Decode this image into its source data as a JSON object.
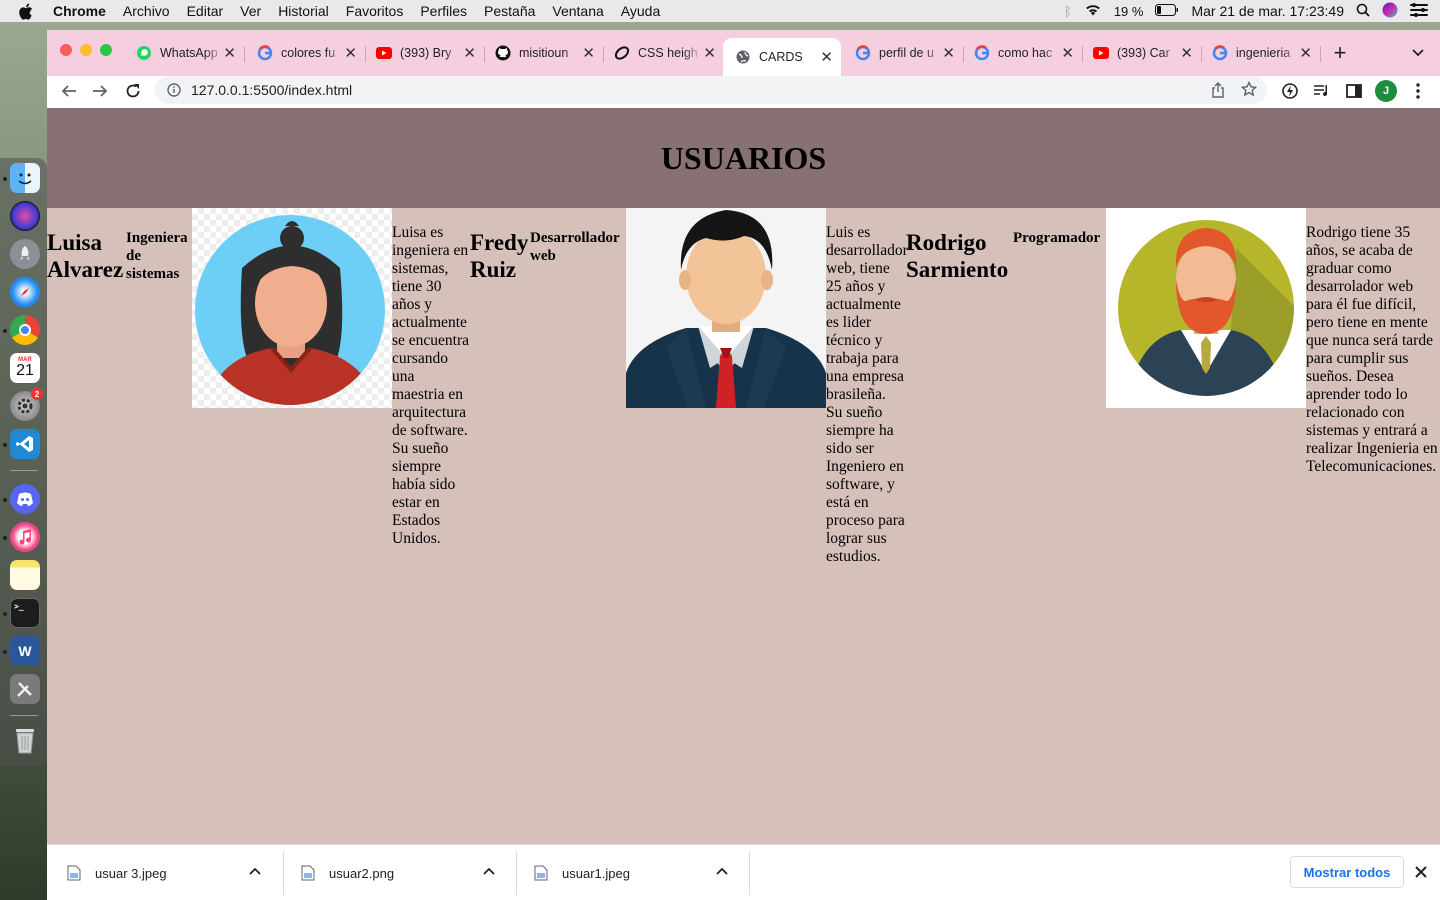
{
  "menubar": {
    "app": "Chrome",
    "items": [
      "Archivo",
      "Editar",
      "Ver",
      "Historial",
      "Favoritos",
      "Perfiles",
      "Pestaña",
      "Ventana",
      "Ayuda"
    ],
    "battery": "19 %",
    "datetime": "Mar 21 de mar.  17:23:49"
  },
  "dock": {
    "calendar_month": "MAR",
    "calendar_day": "21",
    "settings_badge": "2"
  },
  "browser": {
    "tabs": [
      {
        "title": "WhatsApp",
        "icon": "whatsapp-icon"
      },
      {
        "title": "colores fu",
        "icon": "google-icon"
      },
      {
        "title": "(393) Bry",
        "icon": "youtube-icon"
      },
      {
        "title": "misitioun",
        "icon": "github-icon"
      },
      {
        "title": "CSS heigh",
        "icon": "codepen-icon"
      },
      {
        "title": "CARDS",
        "icon": "globe-icon"
      },
      {
        "title": "perfil de u",
        "icon": "google-icon"
      },
      {
        "title": "como hac",
        "icon": "google-icon"
      },
      {
        "title": "(393) Car",
        "icon": "youtube-icon"
      },
      {
        "title": "ingenieria",
        "icon": "google-icon"
      }
    ],
    "url": "127.0.0.1:5500/index.html",
    "profile_initial": "J"
  },
  "page": {
    "title": "USUARIOS",
    "users": [
      {
        "name": "Luisa Alvarez",
        "role": "Ingeniera de sistemas",
        "description": "Luisa es ingeniera en sistemas, tiene 30 años y actualmente se encuentra cursando una maestria en arquitectura de software. Su sueño siempre había sido estar en Estados Unidos."
      },
      {
        "name": "Fredy Ruiz",
        "role": "Desarrollador web",
        "description": "Luis es desarrollador web, tiene 25 años y actualmente es lider técnico y trabaja para una empresa brasileña. Su sueño siempre ha sido ser Ingeniero en software, y está en proceso para lograr sus estudios."
      },
      {
        "name": "Rodrigo Sarmiento",
        "role": "Programador",
        "description": "Rodrigo tiene 35 años, se acaba de graduar como desarrolador web para él fue difícil, pero tiene en mente que nunca será tarde para cumplir sus sueños. Desea aprender todo lo relacionado con sistemas y entrará a realizar Ingenieria en Telecomunicaciones."
      }
    ]
  },
  "downloads": {
    "files": [
      "usuar 3.jpeg",
      "usuar2.png",
      "usuar1.jpeg"
    ],
    "show_all": "Mostrar todos"
  },
  "colors": {
    "header_bg": "#877172",
    "page_bg": "#d6c0ba",
    "tabstrip_bg": "#f5cfe0"
  }
}
